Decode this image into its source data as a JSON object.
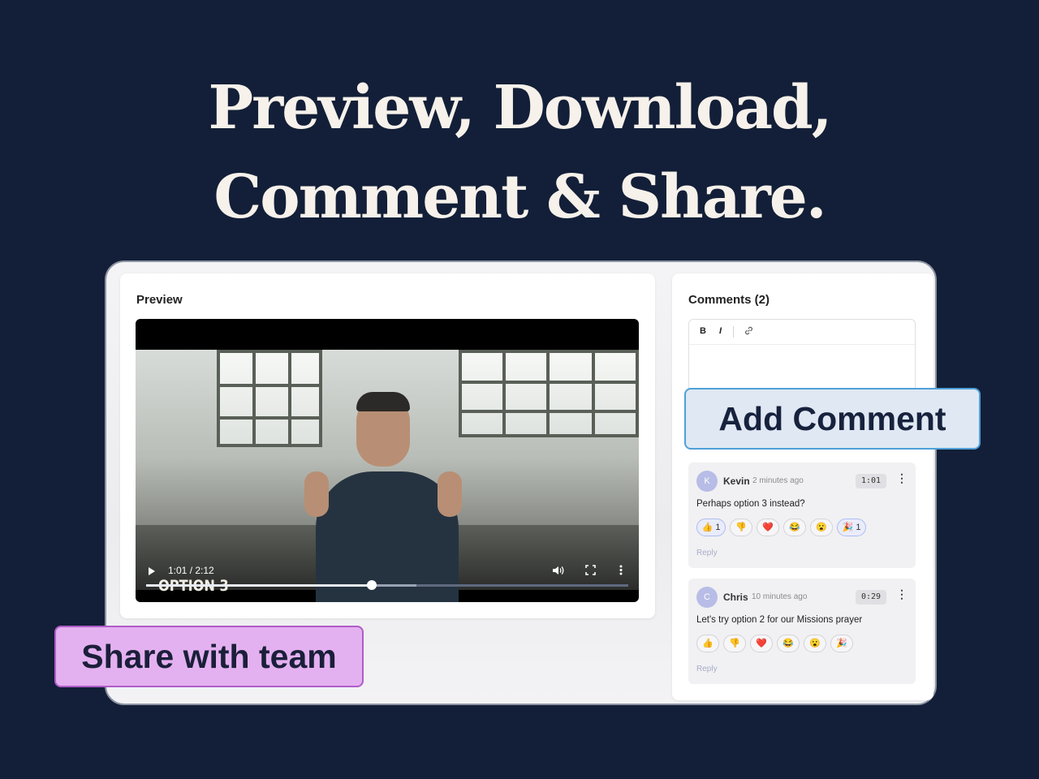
{
  "headline": {
    "line1": "Preview, Download,",
    "line2": "Comment & Share."
  },
  "preview": {
    "title": "Preview",
    "video": {
      "overlay_text": "OPTION 3",
      "time": "1:01 / 2:12",
      "progress": 0.468,
      "buffered": 0.56
    }
  },
  "comments": {
    "title": "Comments (2)",
    "editor": {
      "bold": "B",
      "italic": "I",
      "link_icon": "link-icon"
    },
    "add_button": "Add Comment",
    "items": [
      {
        "initial": "K",
        "name": "Kevin",
        "time": "2 minutes ago",
        "stamp": "1:01",
        "text": "Perhaps option 3 instead?",
        "reactions": [
          {
            "emoji": "👍",
            "count": "1",
            "active": true
          },
          {
            "emoji": "👎",
            "count": "",
            "active": false
          },
          {
            "emoji": "❤️",
            "count": "",
            "active": false
          },
          {
            "emoji": "😂",
            "count": "",
            "active": false
          },
          {
            "emoji": "😮",
            "count": "",
            "active": false
          },
          {
            "emoji": "🎉",
            "count": "1",
            "active": true
          }
        ],
        "reply": "Reply"
      },
      {
        "initial": "C",
        "name": "Chris",
        "time": "10 minutes ago",
        "stamp": "0:29",
        "text": "Let's try option 2 for our Missions prayer",
        "reactions": [
          {
            "emoji": "👍",
            "count": "",
            "active": false
          },
          {
            "emoji": "👎",
            "count": "",
            "active": false
          },
          {
            "emoji": "❤️",
            "count": "",
            "active": false
          },
          {
            "emoji": "😂",
            "count": "",
            "active": false
          },
          {
            "emoji": "😮",
            "count": "",
            "active": false
          },
          {
            "emoji": "🎉",
            "count": "",
            "active": false
          }
        ],
        "reply": "Reply"
      }
    ]
  },
  "share_button": "Share with team"
}
